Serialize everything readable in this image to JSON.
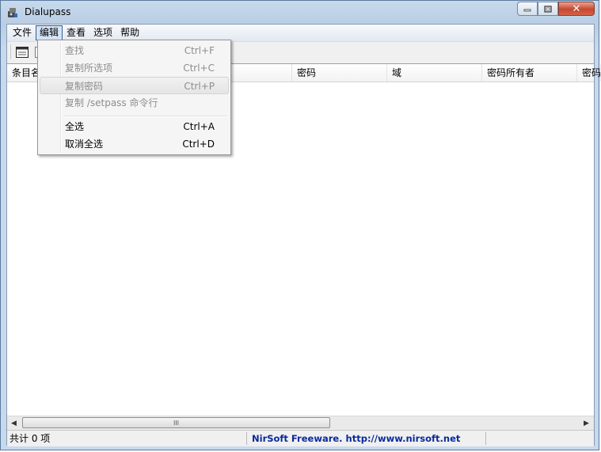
{
  "window": {
    "title": "Dialupass",
    "close_glyph": "✕"
  },
  "menubar": {
    "items": [
      "文件",
      "编辑",
      "查看",
      "选项",
      "帮助"
    ],
    "active_index": 1
  },
  "columns": [
    "条目名",
    "",
    "密码",
    "域",
    "密码所有者",
    "密码"
  ],
  "edit_menu": {
    "items": [
      {
        "label": "查找",
        "shortcut": "Ctrl+F",
        "enabled": false
      },
      {
        "label": "复制所选项",
        "shortcut": "Ctrl+C",
        "enabled": false
      },
      {
        "label": "复制密码",
        "shortcut": "Ctrl+P",
        "enabled": false,
        "hover": true
      },
      {
        "label": "复制 /setpass 命令行",
        "shortcut": "",
        "enabled": false
      },
      {
        "label": "全选",
        "shortcut": "Ctrl+A",
        "enabled": true
      },
      {
        "label": "取消全选",
        "shortcut": "Ctrl+D",
        "enabled": true
      }
    ]
  },
  "statusbar": {
    "count_text": "共计 0 项",
    "credit_text": "NirSoft Freeware.  http://www.nirsoft.net"
  },
  "scrollbar": {
    "left_arrow": "◀",
    "right_arrow": "▶",
    "thumb_grip": "III"
  },
  "colors": {
    "link": "#0a2a9c",
    "disabled": "#8d8d8d",
    "frame": "#b9cde4"
  }
}
